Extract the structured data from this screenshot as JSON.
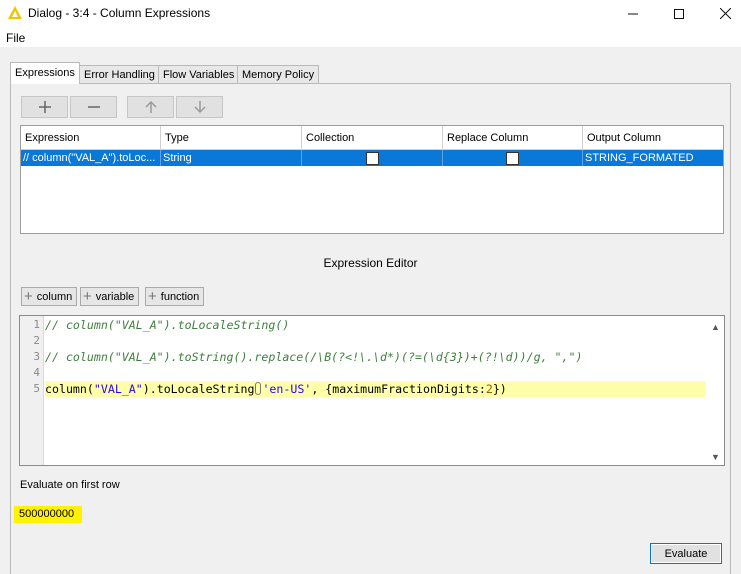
{
  "window": {
    "title": "Dialog - 3:4 - Column Expressions"
  },
  "menu": {
    "file": "File"
  },
  "tabs": [
    {
      "label": "Expressions",
      "active": true
    },
    {
      "label": "Error Handling"
    },
    {
      "label": "Flow Variables"
    },
    {
      "label": "Memory Policy"
    }
  ],
  "table": {
    "headers": [
      "Expression",
      "Type",
      "Collection",
      "Replace Column",
      "Output Column"
    ],
    "rows": [
      {
        "expression": "// column(\"VAL_A\").toLoc...",
        "type": "String",
        "collection": false,
        "replace_column": false,
        "output_column": "STRING_FORMATED"
      }
    ]
  },
  "editor": {
    "title": "Expression Editor",
    "insert_buttons": [
      "column",
      "variable",
      "function"
    ],
    "line_numbers": [
      "1",
      "2",
      "3",
      "4",
      "5"
    ],
    "lines": {
      "l1": "// column(\"VAL_A\").toLocaleString()",
      "l3": "// column(\"VAL_A\").toString().replace(/\\B(?<!\\.\\d*)(?=(\\d{3})+(?!\\d))/g, \",\")",
      "l5_a": "column(",
      "l5_b": "\"VAL_A\"",
      "l5_c": ").toLocaleString",
      "l5_d": "'en-US'",
      "l5_e": ", {maximumFractionDigits:",
      "l5_f": "2",
      "l5_g": "})"
    }
  },
  "evaluate": {
    "label": "Evaluate on first row",
    "result": "500000000",
    "button": "Evaluate"
  }
}
